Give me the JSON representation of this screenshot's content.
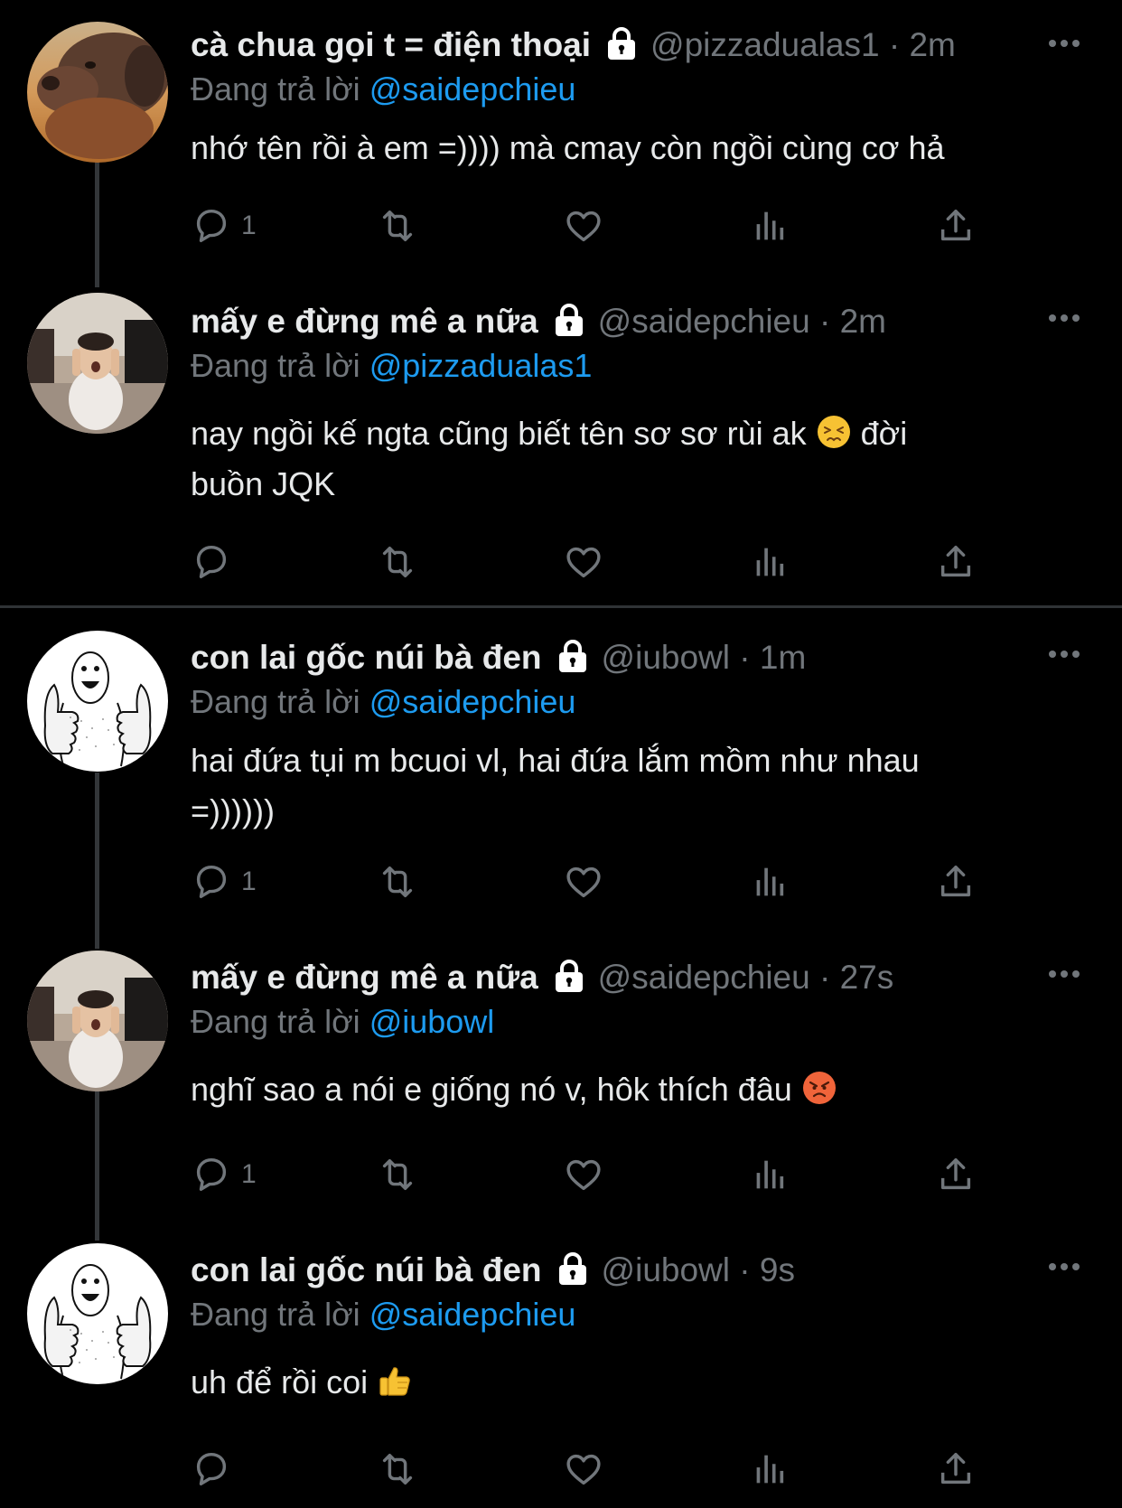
{
  "tweets": [
    {
      "display_name": "cà chua gọi t = điện thoại",
      "handle": "@pizzadualas1",
      "separator": "·",
      "time": "2m",
      "reply_prefix": "Đang trả lời",
      "reply_to": "@saidepchieu",
      "text_line1": "nhớ tên rồi à em =)))) mà cmay còn ngồi cùng cơ hả",
      "reply_count": "1",
      "avatar": "dog-avatar"
    },
    {
      "display_name": "mấy e đừng mê a nữa",
      "handle": "@saidepchieu",
      "separator": "·",
      "time": "2m",
      "reply_prefix": "Đang trả lời",
      "reply_to": "@pizzadualas1",
      "text_line1_a": "nay ngồi kế ngta cũng biết tên sơ sơ rùi ak",
      "text_line1_b": "đời",
      "text_line2": "buồn JQK",
      "reply_count": "",
      "avatar": "person-avatar",
      "emoji": "persevering-face"
    },
    {
      "display_name": "con lai gốc núi bà đen",
      "handle": "@iubowl",
      "separator": "·",
      "time": "1m",
      "reply_prefix": "Đang trả lời",
      "reply_to": "@saidepchieu",
      "text_line1": "hai đứa tụi m bcuoi vl, hai đứa lắm mồm như nhau",
      "text_line2": "=))))))",
      "reply_count": "1",
      "avatar": "thumbs-up-drawing-avatar"
    },
    {
      "display_name": "mấy e đừng mê a nữa",
      "handle": "@saidepchieu",
      "separator": "·",
      "time": "27s",
      "reply_prefix": "Đang trả lời",
      "reply_to": "@iubowl",
      "text_line1": "nghĩ sao a nói e giống nó v, hôk thích đâu",
      "reply_count": "1",
      "avatar": "person-avatar",
      "emoji": "angry-face"
    },
    {
      "display_name": "con lai gốc núi bà đen",
      "handle": "@iubowl",
      "separator": "·",
      "time": "9s",
      "reply_prefix": "Đang trả lời",
      "reply_to": "@saidepchieu",
      "text_line1": "uh để rồi coi",
      "reply_count": "",
      "avatar": "thumbs-up-drawing-avatar",
      "emoji": "thumbs-up"
    }
  ],
  "colors": {
    "background": "#000000",
    "text_primary": "#e7e9ea",
    "text_secondary": "#71767b",
    "link": "#1d9bf0",
    "thread_line": "#333639",
    "divider": "#2f3336"
  },
  "icons": [
    "lock-icon",
    "more-icon",
    "reply-icon",
    "retweet-icon",
    "like-icon",
    "views-icon",
    "share-icon"
  ]
}
